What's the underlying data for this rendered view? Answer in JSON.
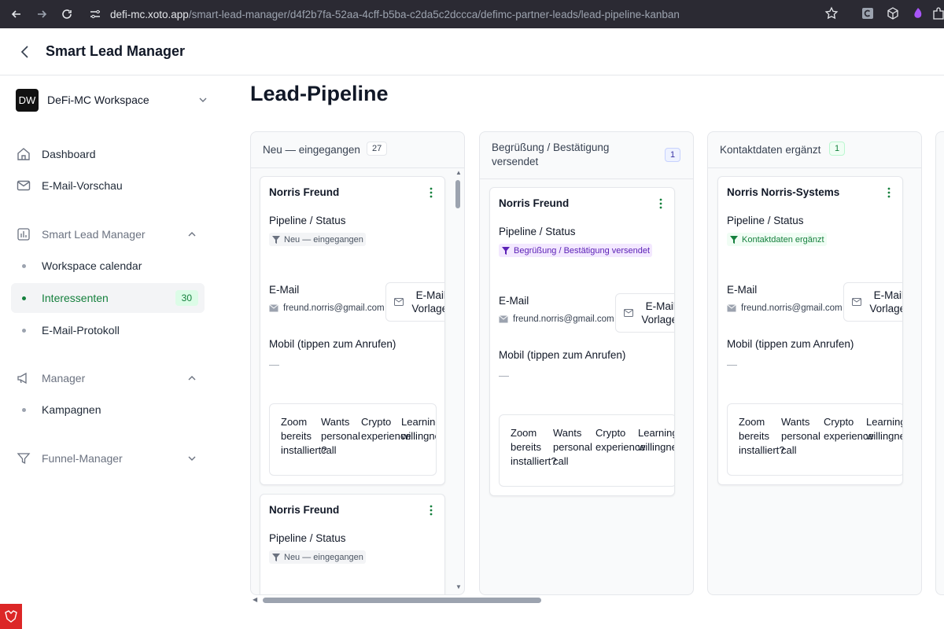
{
  "browser": {
    "url_host": "defi-mc.xoto.app",
    "url_path": "/smart-lead-manager/d4f2b7fa-52aa-4cff-b5ba-c2da5c2dccca/defimc-partner-leads/lead-pipeline-kanban"
  },
  "header": {
    "title": "Smart Lead Manager"
  },
  "sidebar": {
    "workspace": {
      "avatar": "DW",
      "name": "DeFi-MC Workspace"
    },
    "dashboard": "Dashboard",
    "email_preview": "E-Mail-Vorschau",
    "slm_section": "Smart Lead Manager",
    "workspace_calendar": "Workspace calendar",
    "leads": {
      "label": "Interessenten",
      "count": "30"
    },
    "email_log": "E-Mail-Protokoll",
    "manager_section": "Manager",
    "campaigns": "Kampagnen",
    "funnel_section": "Funnel-Manager"
  },
  "main": {
    "page_title": "Lead-Pipeline",
    "columns": [
      {
        "title": "Neu — eingegangen",
        "count": "27",
        "cards": [
          {
            "name": "Norris Freund",
            "status_label": "Pipeline / Status",
            "status": "Neu — eingegangen",
            "email_label": "E-Mail",
            "email": "freund.norris@gmail.com",
            "template_button": "E-Mail-Vorlagen",
            "mobile_label": "Mobil (tippen zum Anrufen)",
            "mobile": "—",
            "tags": [
              "Zoom bereits installiert?",
              "Wants personal call",
              "Crypto experience",
              "Learning willingness"
            ]
          },
          {
            "name": "Norris Freund",
            "status_label": "Pipeline / Status",
            "status": "Neu — eingegangen"
          }
        ]
      },
      {
        "title": "Begrüßung / Bestätigung versendet",
        "count": "1",
        "cards": [
          {
            "name": "Norris Freund",
            "status_label": "Pipeline / Status",
            "status": "Begrüßung / Bestätigung versendet",
            "email_label": "E-Mail",
            "email": "freund.norris@gmail.com",
            "template_button": "E-Mail-Vorlagen",
            "mobile_label": "Mobil (tippen zum Anrufen)",
            "mobile": "—",
            "tags": [
              "Zoom bereits installiert?",
              "Wants personal call",
              "Crypto experience",
              "Learning willingness"
            ]
          }
        ]
      },
      {
        "title": "Kontaktdaten ergänzt",
        "count": "1",
        "cards": [
          {
            "name": "Norris Norris-Systems",
            "status_label": "Pipeline / Status",
            "status": "Kontaktdaten ergänzt",
            "email_label": "E-Mail",
            "email": "freund.norris@gmail.com",
            "template_button": "E-Mail-Vorlagen",
            "mobile_label": "Mobil (tippen zum Anrufen)",
            "mobile": "—",
            "tags": [
              "Zoom bereits installiert?",
              "Wants personal call",
              "Crypto experience",
              "Learning willingness"
            ]
          }
        ]
      }
    ]
  },
  "colors": {
    "accent_green": "#15803d",
    "status_purple": "#6d28d9",
    "dark_bar": "#2b2a33"
  }
}
